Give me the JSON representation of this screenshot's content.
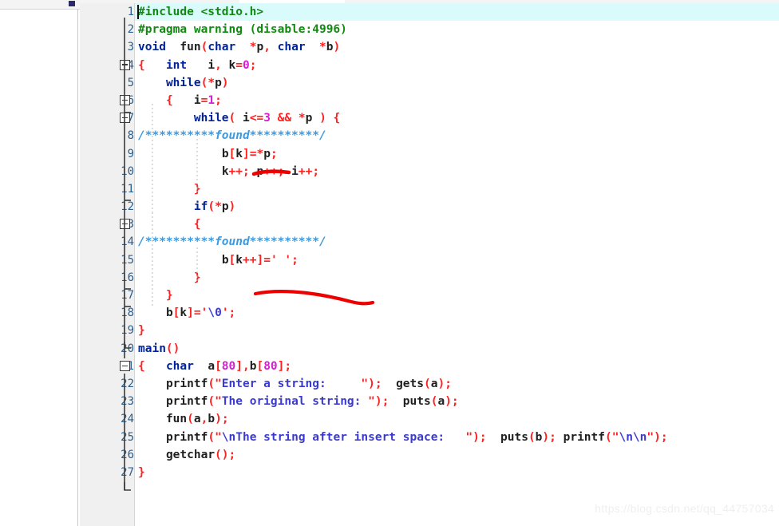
{
  "window": {
    "watermark": "https://blog.csdn.net/qq_44757034"
  },
  "editor": {
    "language": "C",
    "current_line": 1,
    "total_lines": 27,
    "colors": {
      "keyword": "#00229b",
      "preprocessor": "#118a11",
      "operator": "#ff2020",
      "string": "#3a3ad0",
      "number": "#d21fd2",
      "comment": "#3b9ae1",
      "current_line_highlight": "#d9fbfb",
      "gutter_background": "#f0f0f0",
      "line_number": "#2b5f8f",
      "annotation": "#ee0000"
    },
    "line_numbers": [
      1,
      2,
      3,
      4,
      5,
      6,
      7,
      8,
      9,
      10,
      11,
      12,
      13,
      14,
      15,
      16,
      17,
      18,
      19,
      20,
      21,
      22,
      23,
      24,
      25,
      26,
      27
    ],
    "lines": [
      "#include <stdio.h>",
      "#pragma warning (disable:4996)",
      "void  fun(char  *p, char  *b)",
      "{   int   i, k=0;",
      "    while(*p)",
      "    {   i=1;",
      "        while( i<=3 && *p ) {",
      "/**********found**********/",
      "            b[k]=*p;",
      "            k++; p++; i++;",
      "        }",
      "        if(*p)",
      "        {",
      "/**********found**********/",
      "            b[k++]=' ';",
      "        }",
      "    }",
      "    b[k]='\\0';",
      "}",
      "main()",
      "{   char  a[80],b[80];",
      "    printf(\"Enter a string:     \");  gets(a);",
      "    printf(\"The original string: \");  puts(a);",
      "    fun(a,b);",
      "    printf(\"\\nThe string after insert space:   \");  puts(b); printf(\"\\n\\n\");",
      "    getchar();",
      "}"
    ],
    "fold_markers": [
      {
        "line": 4,
        "state": "expanded"
      },
      {
        "line": 6,
        "state": "expanded"
      },
      {
        "line": 7,
        "state": "expanded"
      },
      {
        "line": 13,
        "state": "expanded"
      },
      {
        "line": 21,
        "state": "expanded"
      }
    ]
  },
  "annotations": [
    {
      "name": "underline-bk-equals-p",
      "shape": "straight-underline",
      "target_line": 9
    },
    {
      "name": "long-curve-stroke",
      "shape": "long-curve",
      "target_line": 16
    }
  ]
}
